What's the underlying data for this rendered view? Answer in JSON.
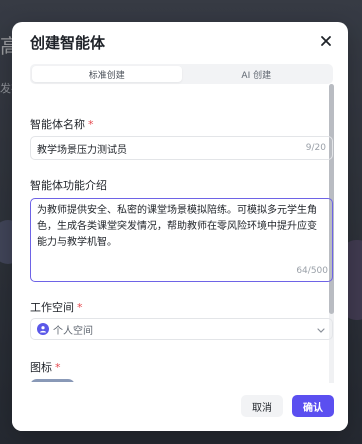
{
  "background": {
    "fragment_1": "高",
    "fragment_2": "发布"
  },
  "modal": {
    "title": "创建智能体",
    "close_icon": "close-icon",
    "tabs": [
      {
        "label": "标准创建",
        "active": true
      },
      {
        "label": "AI 创建",
        "active": false
      }
    ],
    "name_field": {
      "label": "智能体名称",
      "required_mark": "*",
      "value": "教学场景压力测试员",
      "counter": "9/20"
    },
    "intro_field": {
      "label": "智能体功能介绍",
      "value": "为教师提供安全、私密的课堂场景模拟陪练。可模拟多元学生角色，生成各类课堂突发情况，帮助教师在零风险环境中提升应变能力与教学机智。",
      "counter": "64/500"
    },
    "workspace_field": {
      "label": "工作空间",
      "required_mark": "*",
      "value": "个人空间",
      "avatar_icon": "user-icon",
      "dropdown_icon": "chevron-down-icon"
    },
    "icon_field": {
      "label": "图标",
      "required_mark": "*",
      "tile_icon": "layers-icon"
    },
    "buttons": {
      "cancel": "取消",
      "confirm": "确认"
    }
  },
  "colors": {
    "accent": "#5b4ff0",
    "required": "#e5484d",
    "focus_border": "#6e63e6"
  }
}
